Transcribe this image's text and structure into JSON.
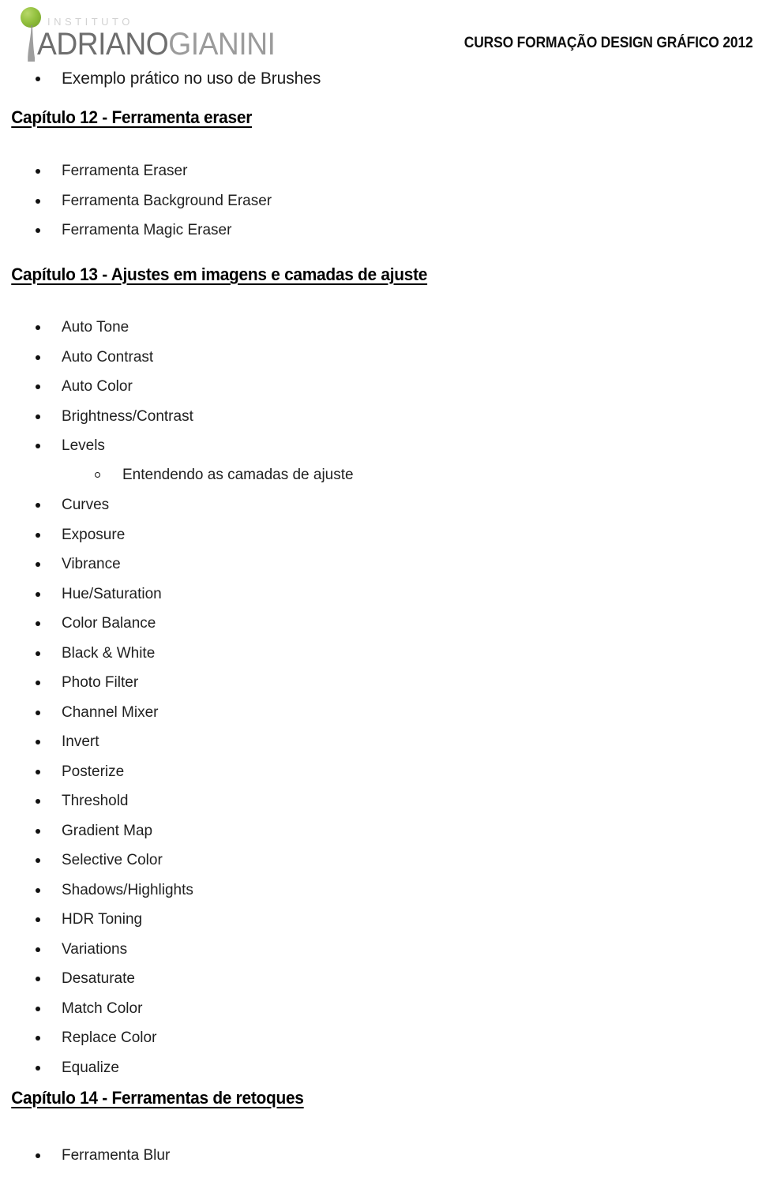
{
  "header": {
    "logo": {
      "institute_label": "INSTITUTO",
      "name_part1": "ADRIANO",
      "name_part2": "GIANINI",
      "sphere_color": "#93c13f",
      "name_color_1": "#6e6e6e",
      "name_color_2": "#9b9b9b",
      "institute_color": "#d2d2d2"
    },
    "course_title": "CURSO FORMAÇÃO DESIGN GRÁFICO 2012"
  },
  "intro": {
    "item": "Exemplo prático no uso de Brushes"
  },
  "chapters": [
    {
      "heading": "Capítulo 12 - Ferramenta eraser",
      "items": [
        "Ferramenta Eraser",
        "Ferramenta Background Eraser",
        "Ferramenta Magic Eraser"
      ]
    },
    {
      "heading": "Capítulo 13 - Ajustes em imagens e camadas de ajuste",
      "items_before_sub": [
        "Auto Tone",
        "Auto Contrast",
        "Auto Color",
        "Brightness/Contrast",
        "Levels"
      ],
      "sub_item": "Entendendo as camadas de ajuste",
      "items_after_sub": [
        "Curves",
        "Exposure",
        "Vibrance",
        "Hue/Saturation",
        "Color Balance",
        "Black & White",
        "Photo Filter",
        "Channel Mixer",
        "Invert",
        "Posterize",
        "Threshold",
        "Gradient Map",
        "Selective Color",
        "Shadows/Highlights",
        "HDR Toning",
        "Variations",
        "Desaturate",
        "Match Color",
        "Replace Color",
        "Equalize"
      ]
    },
    {
      "heading": "Capítulo 14 - Ferramentas de retoques",
      "items": [
        "Ferramenta Blur"
      ]
    }
  ]
}
